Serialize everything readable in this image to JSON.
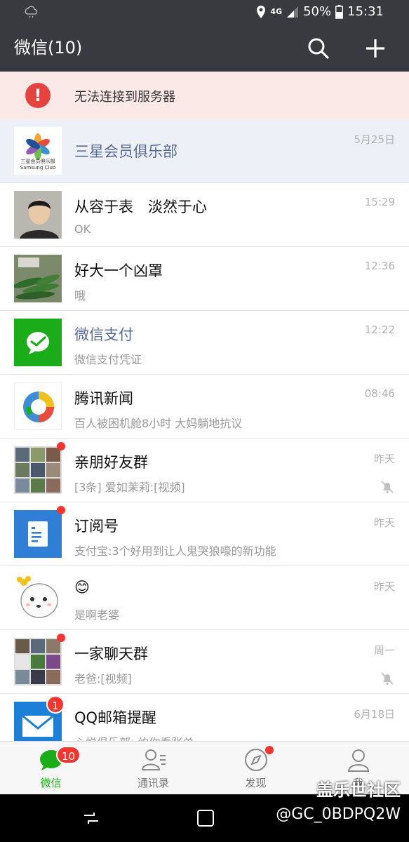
{
  "status": {
    "battery": "50%",
    "time": "15:31",
    "network": "4G"
  },
  "header": {
    "title": "微信(10)"
  },
  "banner": {
    "text": "无法连接到服务器"
  },
  "chats": [
    {
      "name": "三星会员俱乐部",
      "message": "",
      "time": "5月25日",
      "avatar_text": "三星会员俱乐部",
      "avatar_sub": "Samsung Club"
    },
    {
      "name": "从容于表　淡然于心",
      "message": "OK",
      "time": "15:29"
    },
    {
      "name": "好大一个凶罩",
      "message": "哦",
      "time": "12:36"
    },
    {
      "name": "微信支付",
      "message": "微信支付凭证",
      "time": "12:22"
    },
    {
      "name": "腾讯新闻",
      "message": "百人被困机舱8小时 大妈躺地抗议",
      "time": "08:46"
    },
    {
      "name": "亲朋好友群",
      "message": "[3条] 爱如茉莉:[视频]",
      "time": "昨天"
    },
    {
      "name": "订阅号",
      "message": "支付宝:3个好用到让人鬼哭狼嚎的新功能",
      "time": "昨天"
    },
    {
      "name": "😊",
      "message": "是啊老婆",
      "time": "昨天"
    },
    {
      "name": "一家聊天群",
      "message": "老爸:[视频]",
      "time": "周一"
    },
    {
      "name": "QQ邮箱提醒",
      "message": "心悦俱乐部: 约你看账单",
      "time": "6月18日",
      "badge": "1"
    }
  ],
  "tabs": [
    {
      "label": "微信",
      "badge": "10"
    },
    {
      "label": "通讯录"
    },
    {
      "label": "发现"
    },
    {
      "label": "我"
    }
  ],
  "watermark": {
    "brand": "盖乐世社区",
    "user": "@GC_0BDPQ2W"
  },
  "colors": {
    "header": "#393a3f",
    "accent": "#1aad19",
    "badge": "#f43530",
    "banner": "#fbe9e8"
  }
}
